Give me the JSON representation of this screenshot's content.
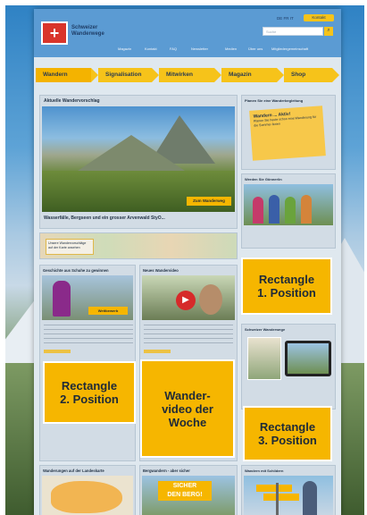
{
  "header": {
    "brand_line1": "Schweizer",
    "brand_line2": "Wanderwege",
    "languages": "DE FR IT",
    "top_button": "Kontakt",
    "search_placeholder": "Suche",
    "top_links": [
      "Magazin",
      "Kontakt",
      "FAQ",
      "Newsletter",
      "Medien",
      "Über uns",
      "Mitgliedergemeinschaft"
    ]
  },
  "nav": {
    "tabs": [
      "Wandern",
      "Signalisation",
      "Mitwirken",
      "Magazin",
      "Shop"
    ]
  },
  "main": {
    "hero_title": "Aktuelle Wandervorschlag",
    "hero_badge": "Zum Wanderweg",
    "hero_caption": "Wasserfälle, Bergseen und ein grosser Arvenwald StyO...",
    "map_button": "Unsere Wandervorschläge auf der Karte ansehen",
    "section1_title": "Geschichte aus Schuhe zu gewinnen",
    "section1_badge": "Wettbewerb",
    "section2_title": "Neues Wandervideo",
    "section3_title": "Wanderungen auf der Landeskarte",
    "section4_title": "Bergwandern - aber sicher",
    "section4_banner_line1": "SICHER",
    "section4_banner_line2": "DEN BERG!"
  },
  "side": {
    "box1_title": "Planen Sie eine Wanderbegleitung",
    "note_title": "Wandern ... Aktiv!",
    "note_text": "Planen Sie heute schon eine Wanderung für die Sommer-ferien",
    "box2_title": "Werden Sie Gönner/in",
    "box3_title": "Schweizer Wanderwege",
    "box4_title": "Wandern mit Schildern"
  },
  "overlays": {
    "rect1": "Rectangle\n1. Position",
    "rect2": "Rectangle\n2. Position",
    "rect3": "Rectangle\n3. Position",
    "video": "Wander-\nvideo der\nWoche"
  },
  "colors": {
    "accent": "#f6b600",
    "header_blue": "#5b9bd3",
    "brand_red": "#d9352b"
  }
}
